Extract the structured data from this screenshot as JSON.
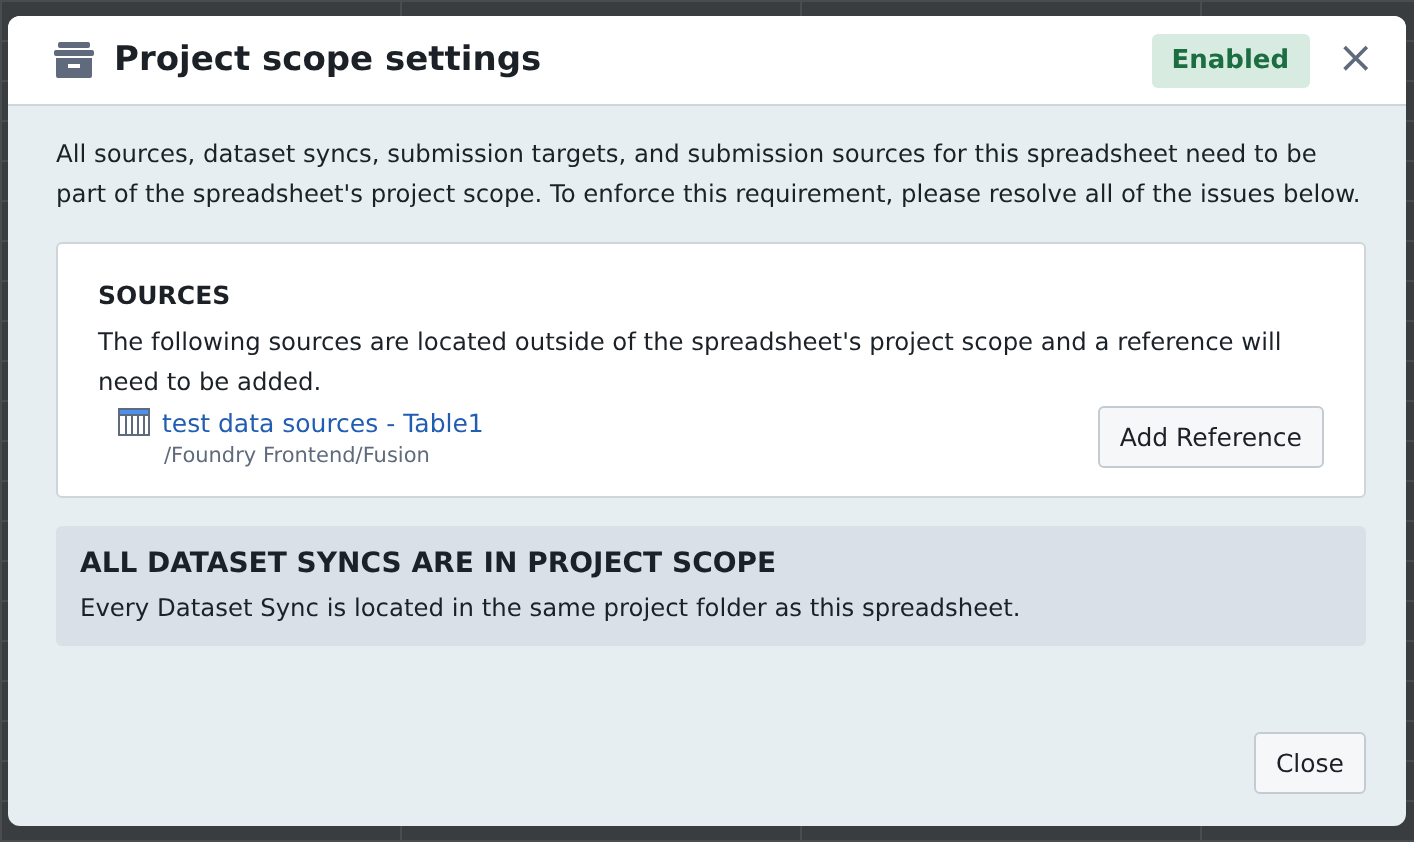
{
  "dialog": {
    "title": "Project scope settings",
    "status_badge": "Enabled",
    "close_icon": "×",
    "intro": "All sources, dataset syncs, submission targets, and submission sources for this spreadsheet need to be part of the spreadsheet's project scope. To enforce this requirement, please resolve all of the issues below.",
    "sections": [
      {
        "kind": "card",
        "heading": "SOURCES",
        "description": "The following sources are located outside of the spreadsheet's project scope and a reference will need to be added.",
        "items": [
          {
            "name": "test data sources - Table1",
            "path": "/Foundry Frontend/Fusion",
            "action": "Add Reference"
          }
        ]
      },
      {
        "kind": "callout",
        "heading": "ALL DATASET SYNCS ARE IN PROJECT SCOPE",
        "description": "Every Dataset Sync is located in the same project folder as this spreadsheet."
      }
    ],
    "footer_button": "Close"
  }
}
